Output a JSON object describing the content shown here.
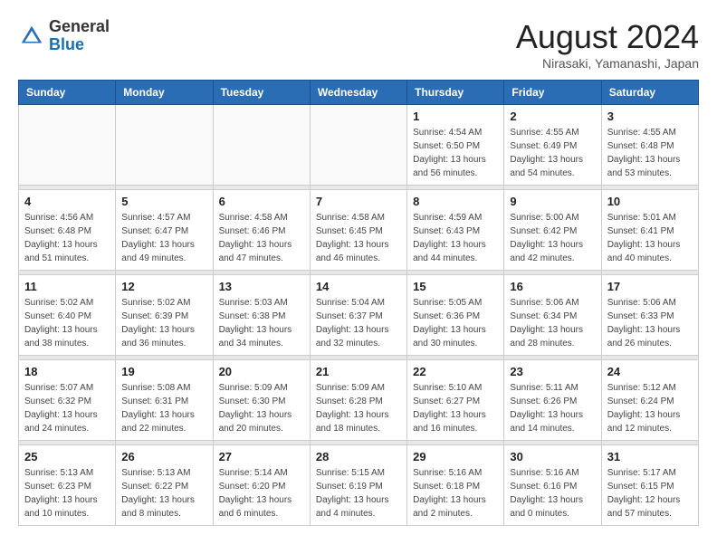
{
  "header": {
    "logo_general": "General",
    "logo_blue": "Blue",
    "title": "August 2024",
    "location": "Nirasaki, Yamanashi, Japan"
  },
  "weekdays": [
    "Sunday",
    "Monday",
    "Tuesday",
    "Wednesday",
    "Thursday",
    "Friday",
    "Saturday"
  ],
  "weeks": [
    [
      {
        "day": "",
        "info": ""
      },
      {
        "day": "",
        "info": ""
      },
      {
        "day": "",
        "info": ""
      },
      {
        "day": "",
        "info": ""
      },
      {
        "day": "1",
        "info": "Sunrise: 4:54 AM\nSunset: 6:50 PM\nDaylight: 13 hours\nand 56 minutes."
      },
      {
        "day": "2",
        "info": "Sunrise: 4:55 AM\nSunset: 6:49 PM\nDaylight: 13 hours\nand 54 minutes."
      },
      {
        "day": "3",
        "info": "Sunrise: 4:55 AM\nSunset: 6:48 PM\nDaylight: 13 hours\nand 53 minutes."
      }
    ],
    [
      {
        "day": "4",
        "info": "Sunrise: 4:56 AM\nSunset: 6:48 PM\nDaylight: 13 hours\nand 51 minutes."
      },
      {
        "day": "5",
        "info": "Sunrise: 4:57 AM\nSunset: 6:47 PM\nDaylight: 13 hours\nand 49 minutes."
      },
      {
        "day": "6",
        "info": "Sunrise: 4:58 AM\nSunset: 6:46 PM\nDaylight: 13 hours\nand 47 minutes."
      },
      {
        "day": "7",
        "info": "Sunrise: 4:58 AM\nSunset: 6:45 PM\nDaylight: 13 hours\nand 46 minutes."
      },
      {
        "day": "8",
        "info": "Sunrise: 4:59 AM\nSunset: 6:43 PM\nDaylight: 13 hours\nand 44 minutes."
      },
      {
        "day": "9",
        "info": "Sunrise: 5:00 AM\nSunset: 6:42 PM\nDaylight: 13 hours\nand 42 minutes."
      },
      {
        "day": "10",
        "info": "Sunrise: 5:01 AM\nSunset: 6:41 PM\nDaylight: 13 hours\nand 40 minutes."
      }
    ],
    [
      {
        "day": "11",
        "info": "Sunrise: 5:02 AM\nSunset: 6:40 PM\nDaylight: 13 hours\nand 38 minutes."
      },
      {
        "day": "12",
        "info": "Sunrise: 5:02 AM\nSunset: 6:39 PM\nDaylight: 13 hours\nand 36 minutes."
      },
      {
        "day": "13",
        "info": "Sunrise: 5:03 AM\nSunset: 6:38 PM\nDaylight: 13 hours\nand 34 minutes."
      },
      {
        "day": "14",
        "info": "Sunrise: 5:04 AM\nSunset: 6:37 PM\nDaylight: 13 hours\nand 32 minutes."
      },
      {
        "day": "15",
        "info": "Sunrise: 5:05 AM\nSunset: 6:36 PM\nDaylight: 13 hours\nand 30 minutes."
      },
      {
        "day": "16",
        "info": "Sunrise: 5:06 AM\nSunset: 6:34 PM\nDaylight: 13 hours\nand 28 minutes."
      },
      {
        "day": "17",
        "info": "Sunrise: 5:06 AM\nSunset: 6:33 PM\nDaylight: 13 hours\nand 26 minutes."
      }
    ],
    [
      {
        "day": "18",
        "info": "Sunrise: 5:07 AM\nSunset: 6:32 PM\nDaylight: 13 hours\nand 24 minutes."
      },
      {
        "day": "19",
        "info": "Sunrise: 5:08 AM\nSunset: 6:31 PM\nDaylight: 13 hours\nand 22 minutes."
      },
      {
        "day": "20",
        "info": "Sunrise: 5:09 AM\nSunset: 6:30 PM\nDaylight: 13 hours\nand 20 minutes."
      },
      {
        "day": "21",
        "info": "Sunrise: 5:09 AM\nSunset: 6:28 PM\nDaylight: 13 hours\nand 18 minutes."
      },
      {
        "day": "22",
        "info": "Sunrise: 5:10 AM\nSunset: 6:27 PM\nDaylight: 13 hours\nand 16 minutes."
      },
      {
        "day": "23",
        "info": "Sunrise: 5:11 AM\nSunset: 6:26 PM\nDaylight: 13 hours\nand 14 minutes."
      },
      {
        "day": "24",
        "info": "Sunrise: 5:12 AM\nSunset: 6:24 PM\nDaylight: 13 hours\nand 12 minutes."
      }
    ],
    [
      {
        "day": "25",
        "info": "Sunrise: 5:13 AM\nSunset: 6:23 PM\nDaylight: 13 hours\nand 10 minutes."
      },
      {
        "day": "26",
        "info": "Sunrise: 5:13 AM\nSunset: 6:22 PM\nDaylight: 13 hours\nand 8 minutes."
      },
      {
        "day": "27",
        "info": "Sunrise: 5:14 AM\nSunset: 6:20 PM\nDaylight: 13 hours\nand 6 minutes."
      },
      {
        "day": "28",
        "info": "Sunrise: 5:15 AM\nSunset: 6:19 PM\nDaylight: 13 hours\nand 4 minutes."
      },
      {
        "day": "29",
        "info": "Sunrise: 5:16 AM\nSunset: 6:18 PM\nDaylight: 13 hours\nand 2 minutes."
      },
      {
        "day": "30",
        "info": "Sunrise: 5:16 AM\nSunset: 6:16 PM\nDaylight: 13 hours\nand 0 minutes."
      },
      {
        "day": "31",
        "info": "Sunrise: 5:17 AM\nSunset: 6:15 PM\nDaylight: 12 hours\nand 57 minutes."
      }
    ]
  ]
}
